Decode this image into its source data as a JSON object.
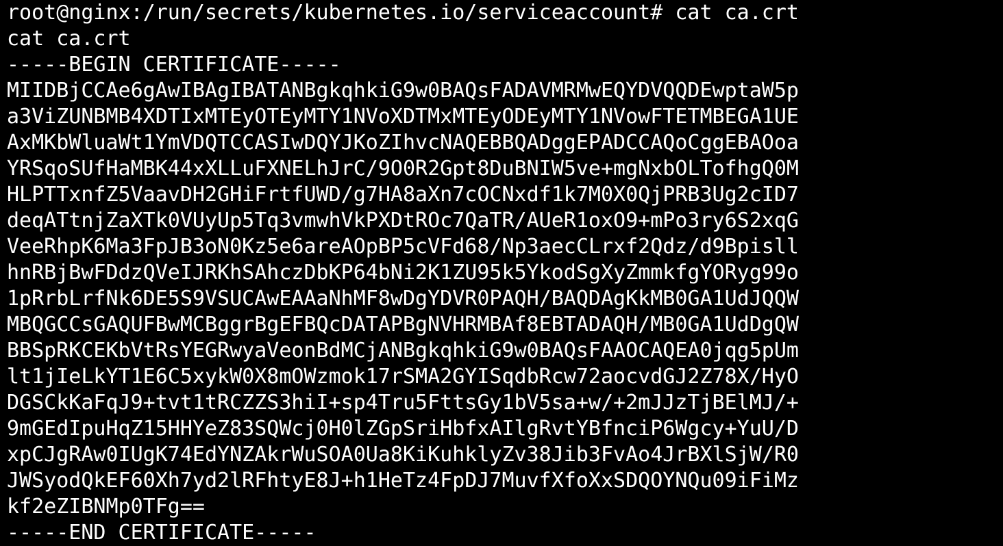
{
  "terminal": {
    "prompt_line": "root@nginx:/run/secrets/kubernetes.io/serviceaccount# cat ca.crt",
    "echo_line": "cat ca.crt",
    "begin_marker": "-----BEGIN CERTIFICATE-----",
    "cert_lines": [
      "MIIDBjCCAe6gAwIBAgIBATANBgkqhkiG9w0BAQsFADAVMRMwEQYDVQQDEwptaW5p",
      "a3ViZUNBMB4XDTIxMTEyOTEyMTY1NVoXDTMxMTEyODEyMTY1NVowFTETMBEGA1UE",
      "AxMKbWluaWt1YmVDQTCCASIwDQYJKoZIhvcNAQEBBQADggEPADCCAQoCggEBAOoa",
      "YRSqoSUfHaMBK44xXLLuFXNELhJrC/9O0R2Gpt8DuBNIW5ve+mgNxbOLTofhgQ0M",
      "HLPTTxnfZ5VaavDH2GHiFrtfUWD/g7HA8aXn7cOCNxdf1k7M0X0QjPRB3Ug2cID7",
      "deqATtnjZaXTk0VUyUp5Tq3vmwhVkPXDtROc7QaTR/AUeR1oxO9+mPo3ry6S2xqG",
      "VeeRhpK6Ma3FpJB3oN0Kz5e6areAOpBP5cVFd68/Np3aecCLrxf2Qdz/d9Bpisll",
      "hnRBjBwFDdzQVeIJRKhSAhczDbKP64bNi2K1ZU95k5YkodSgXyZmmkfgYORyg99o",
      "1pRrbLrfNk6DE5S9VSUCAwEAAaNhMF8wDgYDVR0PAQH/BAQDAgKkMB0GA1UdJQQW",
      "MBQGCCsGAQUFBwMCBggrBgEFBQcDATAPBgNVHRMBAf8EBTADAQH/MB0GA1UdDgQW",
      "BBSpRKCEKbVtRsYEGRwyaVeonBdMCjANBgkqhkiG9w0BAQsFAAOCAQEA0jqg5pUm",
      "lt1jIeLkYT1E6C5xykW0X8mOWzmok17rSMA2GYISqdbRcw72aocvdGJ2Z78X/HyO",
      "DGSCkKaFqJ9+tvt1tRCZZS3hiI+sp4Tru5FttsGy1bV5sa+w/+2mJJzTjBElMJ/+",
      "9mGEdIpuHqZ15HHYeZ83SQWcj0H0lZGpSriHbfxAIlgRvtYBfnciP6Wgcy+YuU/D",
      "xpCJgRAw0IUgK74EdYNZAkrWuSOA0Ua8KiKuhklyZv38Jib3FvAo4JrBXlSjW/R0",
      "JWSyodQkEF60Xh7yd2lRFhtyE8J+h1HeTz4FpDJ7MuvfXfoXxSDQOYNQu09iFiMz",
      "kf2eZIBNMp0TFg=="
    ],
    "end_marker": "-----END CERTIFICATE-----",
    "colors": {
      "background": "#000000",
      "foreground": "#ffffff"
    }
  }
}
